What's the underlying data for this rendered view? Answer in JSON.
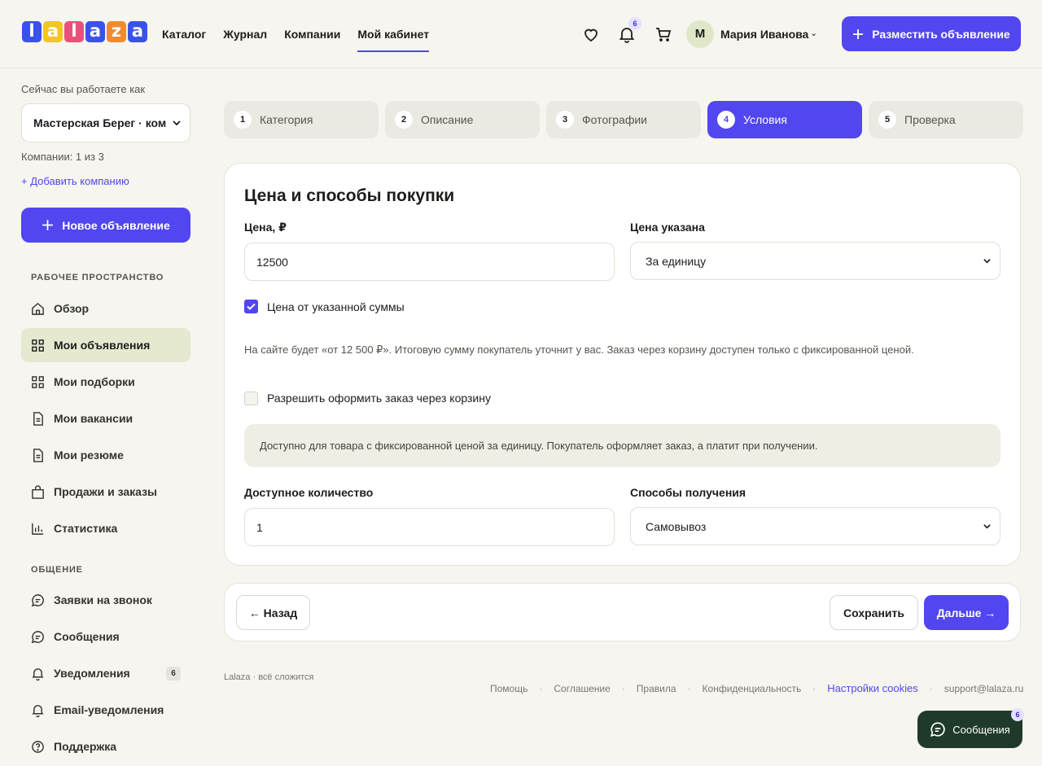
{
  "header": {
    "logo_letters": [
      "l",
      "a",
      "l",
      "a",
      "z",
      "a"
    ],
    "logo_colors": [
      "#3b52e8",
      "#f3c623",
      "#e8527a",
      "#3b52e8",
      "#f08c2e",
      "#3b52e8"
    ],
    "nav": [
      "Каталог",
      "Журнал",
      "Компании",
      "Мой кабинет"
    ],
    "active_nav": "Мой кабинет",
    "notifications_count": "6",
    "avatar_letter": "М",
    "user_name": "Мария Иванова",
    "post_button": "Разместить объявление"
  },
  "sidebar": {
    "working_as_label": "Сейчас вы работаете как",
    "company_select": "Мастерская Берег · ком",
    "companies_count": "Компании: 1 из 3",
    "add_company": "+ Добавить компанию",
    "new_ad_button": "Новое объявление",
    "workspace_title": "РАБОЧЕЕ ПРОСТРАНСТВО",
    "workspace_items": [
      "Обзор",
      "Мои объявления",
      "Мои подборки",
      "Мои вакансии",
      "Мои резюме",
      "Продажи и заказы",
      "Статистика"
    ],
    "communication_title": "ОБЩЕНИЕ",
    "communication_items": [
      "Заявки на звонок",
      "Сообщения",
      "Уведомления",
      "Email-уведомления",
      "Поддержка"
    ],
    "notifications_badge": "6"
  },
  "steps": [
    {
      "num": "1",
      "label": "Категория"
    },
    {
      "num": "2",
      "label": "Описание"
    },
    {
      "num": "3",
      "label": "Фотографии"
    },
    {
      "num": "4",
      "label": "Условия"
    },
    {
      "num": "5",
      "label": "Проверка"
    }
  ],
  "form": {
    "title": "Цена и способы покупки",
    "price_label": "Цена, ₽",
    "price_value": "12500",
    "price_type_label": "Цена указана",
    "price_type_value": "За единицу",
    "from_amount_label": "Цена от указанной суммы",
    "from_amount_checked": true,
    "hint": "На сайте будет «от 12 500 ₽». Итоговую сумму покупатель уточнит у вас. Заказ через корзину доступен только с фиксированной ценой.",
    "cart_label": "Разрешить оформить заказ через корзину",
    "cart_checked": false,
    "info": "Доступно для товара с фиксированной ценой за единицу. Покупатель оформляет заказ, а платит при получении.",
    "qty_label": "Доступное количество",
    "qty_value": "1",
    "delivery_label": "Способы получения",
    "delivery_value": "Самовывоз"
  },
  "actions": {
    "back": "← Назад",
    "save": "Сохранить",
    "next": "Дальше →"
  },
  "footer": {
    "tagline": "Lalaza · всё сложится",
    "links": [
      "Помощь",
      "Соглашение",
      "Правила",
      "Конфиденциальность",
      "Настройки cookies",
      "support@lalaza.ru"
    ]
  },
  "messages_fab": {
    "label": "Сообщения",
    "count": "6"
  },
  "colors": {
    "accent": "#5146ef",
    "active_nav_bg": "#e4e9cf",
    "fab_bg": "#1f3a2a"
  }
}
